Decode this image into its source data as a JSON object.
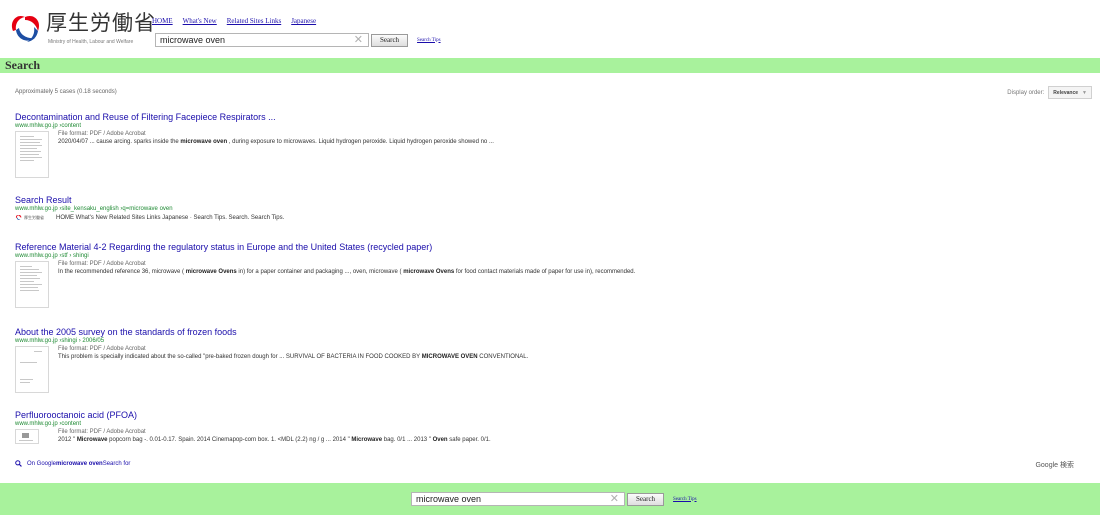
{
  "brand": {
    "name_jp": "厚生労働省",
    "name_en": "Ministry of Health, Labour and Welfare"
  },
  "nav": [
    "HOME",
    "What's New",
    "Related Sites Links",
    "Japanese"
  ],
  "search": {
    "query": "microwave oven",
    "button": "Search",
    "tips": "Search Tips",
    "clear_icon": "close-icon"
  },
  "page_title": "Search",
  "stats": "Approximately 5 cases (0.18 seconds)",
  "sort": {
    "label": "Display order:",
    "value": "Relevance"
  },
  "results": [
    {
      "title": "Decontamination and Reuse of Filtering Facepiece Respirators ...",
      "url": "www.mhlw.go.jp ›content",
      "meta": "File format: PDF / Adobe Acrobat",
      "snippet": {
        "pre": "2020/04/07 ... cause arcing. sparks inside the ",
        "b": "microwave oven",
        "post": " , during exposure to microwaves. Liquid hydrogen peroxide. Liquid hydrogen peroxide showed no ..."
      }
    },
    {
      "title": "Search Result",
      "url": "www.mhlw.go.jp ›site_kensaku_english ›q=microwave oven",
      "snippet_text": "HOME What's New Related Sites Links Japanese · Search Tips. Search. Search Tips."
    },
    {
      "title": "Reference Material 4-2 Regarding the regulatory status in Europe and the United States (recycled paper)",
      "url": "www.mhlw.go.jp ›stf › shingi",
      "meta": "File format: PDF / Adobe Acrobat",
      "snippet": {
        "pre": "In the recommended reference 36, microwave ( ",
        "b": "microwave Ovens",
        "mid": " in) for a paper container and packaging ..., oven, microwave ( ",
        "b2": "microwave Ovens",
        "post": " for food contact materials made of paper for use in), recommended."
      }
    },
    {
      "title": "About the 2005 survey on the standards of frozen foods",
      "url": "www.mhlw.go.jp ›shingi › 2006/05",
      "meta": "File format: PDF / Adobe Acrobat",
      "snippet": {
        "pre": "This problem is specially indicated about the so-called \"pre-baked frozen dough for ... SURVIVAL OF BACTERIA IN FOOD COOKED BY ",
        "b": "MICROWAVE OVEN",
        "post": " CONVENTIONAL."
      }
    },
    {
      "title": "Perfluorooctanoic acid (PFOA)",
      "url": "www.mhlw.go.jp ›content",
      "meta": "File format: PDF / Adobe Acrobat",
      "snippet": {
        "pre": "2012 \" ",
        "b": "Microwave",
        "mid": " popcorn bag -. 0.01-0.17. Spain. 2014 Cinemapop-corn box. 1. <MDL (2.2) ng / g ... 2014 \" ",
        "b2": "Microwave",
        "mid2": " bag. 0/1 ... 2013 \" ",
        "b3": "Oven",
        "post": " safe paper. 0/1."
      }
    }
  ],
  "on_google": {
    "pre": "On Google",
    "b": "microwave oven",
    "post": "Search for"
  },
  "google_brand": "Google 検索",
  "colors": {
    "bar": "#a8f29c",
    "link": "#1a0dab",
    "url": "#1e8a33"
  }
}
